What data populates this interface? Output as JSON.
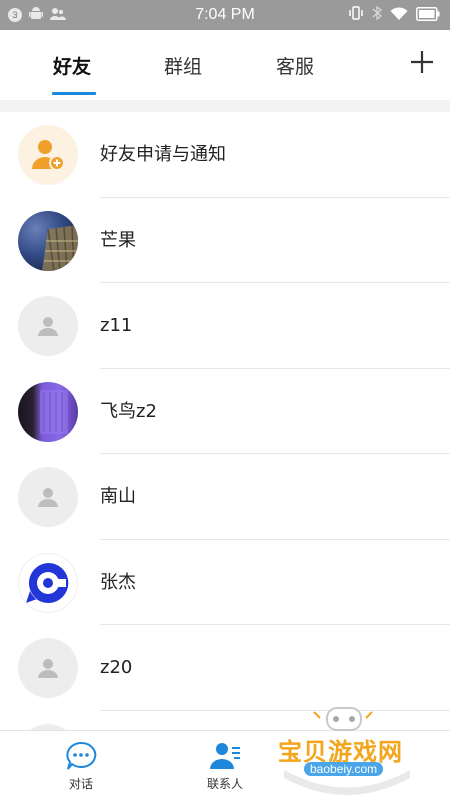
{
  "status_bar": {
    "notification_count": "3",
    "time": "7:04 PM",
    "icons": [
      "android-icon",
      "contacts-sync-icon",
      "vibrate-icon",
      "bluetooth-icon",
      "wifi-icon",
      "battery-icon"
    ]
  },
  "tabs": [
    {
      "label": "好友",
      "active": true
    },
    {
      "label": "群组",
      "active": false
    },
    {
      "label": "客服",
      "active": false
    }
  ],
  "accent_color": "#1d87dc",
  "contacts": [
    {
      "name": "好友申请与通知",
      "avatar": "friend-request-icon"
    },
    {
      "name": "芒果",
      "avatar": "photo"
    },
    {
      "name": "z11",
      "avatar": "default-person-icon"
    },
    {
      "name": "飞鸟z2",
      "avatar": "photo"
    },
    {
      "name": "南山",
      "avatar": "default-person-icon"
    },
    {
      "name": "张杰",
      "avatar": "chat-logo-icon"
    },
    {
      "name": "z20",
      "avatar": "default-person-icon"
    }
  ],
  "bottom_nav": [
    {
      "label": "对话",
      "icon": "chat-bubble-icon",
      "active": false
    },
    {
      "label": "联系人",
      "icon": "contacts-icon",
      "active": true
    }
  ],
  "watermark": {
    "text": "宝贝游戏网",
    "url": "baobeiy.com"
  }
}
